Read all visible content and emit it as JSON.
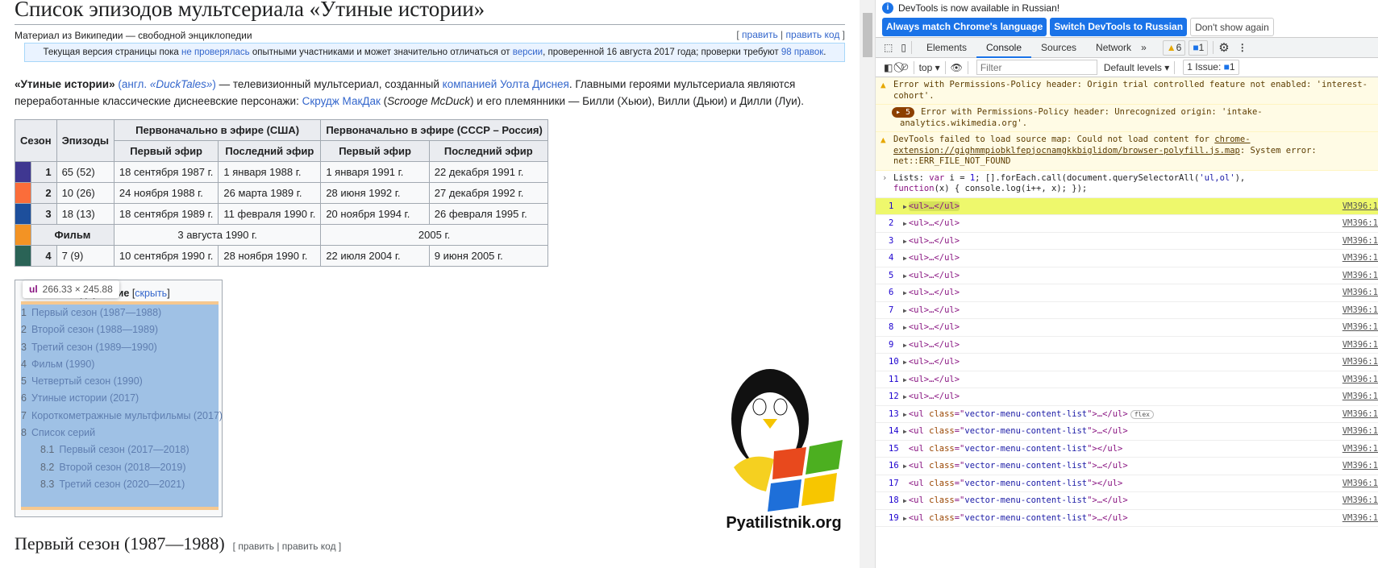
{
  "wiki": {
    "title": "Список эпизодов мультсериала «Утиные истории»",
    "subtitle": "Материал из Википедии — свободной энциклопедии",
    "edit": "править",
    "edit_code": "править код",
    "notice": {
      "t1": "Текущая версия страницы пока ",
      "l1": "не проверялась",
      "t2": " опытными участниками и может значительно отличаться от ",
      "l2": "версии",
      "t3": ", проверенной 16 августа 2017 года; проверки требуют ",
      "l3": "98 правок",
      "t4": "."
    },
    "intro": {
      "b": "«Утиные истории»",
      "l1": "(англ.",
      "i1": " «DuckTales»",
      "l1b": ")",
      "t1": " — телевизионный мультсериал, созданный ",
      "l2": "компанией Уолта Диснея",
      "t2": ". Главными героями мультсериала являются переработанные классические диснеевские персонажи: ",
      "l3": "Скрудж МакДак",
      "t3": " (",
      "i2": "Scrooge McDuck",
      "t4": ") и его племянники — Билли (Хьюи), Вилли (Дьюи) и Дилли (Луи)."
    },
    "table": {
      "h": {
        "season": "Сезон",
        "episodes": "Эпизоды",
        "usa": "Первоначально в эфире (США)",
        "ussr": "Первоначально в эфире (СССР – Россия)",
        "first": "Первый эфир",
        "last": "Последний эфир"
      },
      "rows": [
        {
          "color": "#3f3791",
          "season": "1",
          "episodes": "65 (52)",
          "us1": "18 сентября 1987 г.",
          "us2": "1 января 1988 г.",
          "ru1": "1 января 1991 г.",
          "ru2": "22 декабря 1991 г."
        },
        {
          "color": "#fb6d3a",
          "season": "2",
          "episodes": "10 (26)",
          "us1": "24 ноября 1988 г.",
          "us2": "26 марта 1989 г.",
          "ru1": "28 июня 1992 г.",
          "ru2": "27 декабря 1992 г."
        },
        {
          "color": "#1d4f9c",
          "season": "3",
          "episodes": "18 (13)",
          "us1": "18 сентября 1989 г.",
          "us2": "11 февраля 1990 г.",
          "ru1": "20 ноября 1994 г.",
          "ru2": "26 февраля 1995 г."
        },
        {
          "color": "#f39324",
          "season": "Фильм",
          "us": "3 августа 1990 г.",
          "ru": "2005 г."
        },
        {
          "color": "#2a6356",
          "season": "4",
          "episodes": "7 (9)",
          "us1": "10 сентября 1990 г.",
          "us2": "28 ноября 1990 г.",
          "ru1": "22 июля 2004 г.",
          "ru2": "9 июня 2005 г."
        }
      ]
    },
    "toc": {
      "title": "Содержание",
      "hide": "скрыть",
      "items": [
        {
          "n": "1",
          "t": "Первый сезон (1987—1988)"
        },
        {
          "n": "2",
          "t": "Второй сезон (1988—1989)"
        },
        {
          "n": "3",
          "t": "Третий сезон (1989—1990)"
        },
        {
          "n": "4",
          "t": "Фильм (1990)"
        },
        {
          "n": "5",
          "t": "Четвертый сезон (1990)"
        },
        {
          "n": "6",
          "t": "Утиные истории (2017)"
        },
        {
          "n": "7",
          "t": "Короткометражные мультфильмы (2017)"
        },
        {
          "n": "8",
          "t": "Список серий"
        },
        {
          "n": "8.1",
          "t": "Первый сезон (2017—2018)"
        },
        {
          "n": "8.2",
          "t": "Второй сезон (2018—2019)"
        },
        {
          "n": "8.3",
          "t": "Третий сезон (2020—2021)"
        }
      ]
    },
    "tooltip": {
      "tag": "ul",
      "size": "266.33 × 245.88"
    },
    "h2": "Первый сезон (1987—1988)",
    "h2_edit": "[ править | править код ]",
    "logo_text": "Pyatilistnik.org"
  },
  "devtools": {
    "info": "DevTools is now available in Russian!",
    "btn1": "Always match Chrome's language",
    "btn2": "Switch DevTools to Russian",
    "btn3": "Don't show again",
    "tabs": [
      "Elements",
      "Console",
      "Sources",
      "Network"
    ],
    "warn_count": "6",
    "msg_count": "1",
    "context": "top",
    "filter_placeholder": "Filter",
    "levels": "Default levels",
    "issues": "1 Issue:",
    "issues_count": "1",
    "messages": [
      {
        "type": "warn",
        "text": "Error with Permissions-Policy header: Origin trial controlled feature not enabled: 'interest-cohort'."
      },
      {
        "type": "group",
        "count": "5",
        "text": "Error with Permissions-Policy header: Unrecognized origin: 'intake-analytics.wikimedia.org'."
      },
      {
        "type": "warn",
        "text1": "DevTools failed to load source map: Could not load content for ",
        "link": "chrome-extension://gighmmpiobklfepjocnamgkkbiglidom/browser-polyfill.js.map",
        "text2": ": System error: net::ERR_FILE_NOT_FOUND"
      }
    ],
    "command": {
      "a": "Lists: ",
      "kw1": "var",
      "b": " i = ",
      "n": "1",
      "c": "; [].forEach.call(document.querySelectorAll(",
      "s": "'ul,ol'",
      "d": "),",
      "kw2": "function",
      "e": "(x) { console.log(i++, x); });"
    },
    "source": "VM396:1",
    "rows": [
      {
        "i": "1",
        "tri": true,
        "cls": ""
      },
      {
        "i": "2",
        "tri": true,
        "cls": ""
      },
      {
        "i": "3",
        "tri": true,
        "cls": ""
      },
      {
        "i": "4",
        "tri": true,
        "cls": ""
      },
      {
        "i": "5",
        "tri": true,
        "cls": ""
      },
      {
        "i": "6",
        "tri": true,
        "cls": ""
      },
      {
        "i": "7",
        "tri": true,
        "cls": ""
      },
      {
        "i": "8",
        "tri": true,
        "cls": ""
      },
      {
        "i": "9",
        "tri": true,
        "cls": ""
      },
      {
        "i": "10",
        "tri": true,
        "cls": ""
      },
      {
        "i": "11",
        "tri": true,
        "cls": ""
      },
      {
        "i": "12",
        "tri": true,
        "cls": ""
      },
      {
        "i": "13",
        "tri": true,
        "cls": "vector-menu-content-list",
        "badge": "flex"
      },
      {
        "i": "14",
        "tri": true,
        "cls": "vector-menu-content-list"
      },
      {
        "i": "15",
        "tri": false,
        "cls": "vector-menu-content-list"
      },
      {
        "i": "16",
        "tri": true,
        "cls": "vector-menu-content-list"
      },
      {
        "i": "17",
        "tri": false,
        "cls": "vector-menu-content-list"
      },
      {
        "i": "18",
        "tri": true,
        "cls": "vector-menu-content-list"
      },
      {
        "i": "19",
        "tri": true,
        "cls": "vector-menu-content-list"
      }
    ]
  }
}
